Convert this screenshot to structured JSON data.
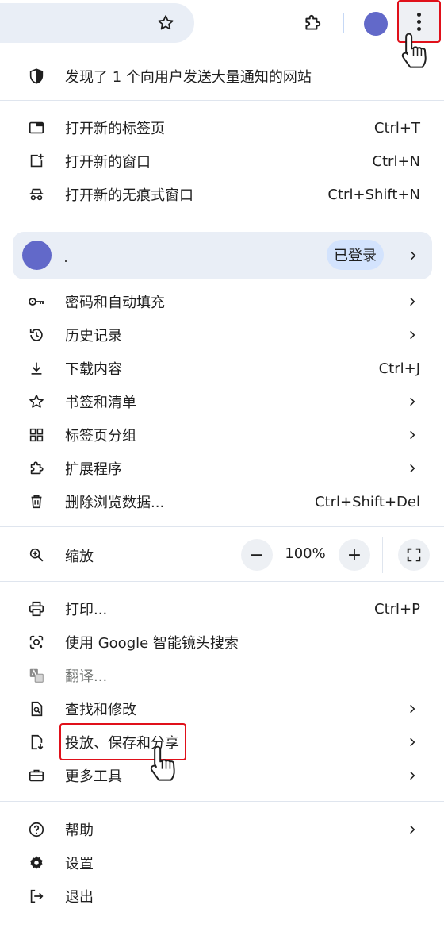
{
  "toolbar": {
    "icons": [
      "star-icon",
      "extension-puzzle-icon",
      "avatar",
      "more-vert-icon"
    ],
    "avatar_color": "#6269c9",
    "highlight_color": "#e0101a"
  },
  "menu": {
    "notification_notice": "发现了 1 个向用户发送大量通知的网站",
    "new_tab": {
      "label": "打开新的标签页",
      "shortcut": "Ctrl+T"
    },
    "new_window": {
      "label": "打开新的窗口",
      "shortcut": "Ctrl+N"
    },
    "new_incognito": {
      "label": "打开新的无痕式窗口",
      "shortcut": "Ctrl+Shift+N"
    },
    "profile": {
      "status": "已登录"
    },
    "passwords": {
      "label": "密码和自动填充"
    },
    "history": {
      "label": "历史记录"
    },
    "downloads": {
      "label": "下载内容",
      "shortcut": "Ctrl+J"
    },
    "bookmarks": {
      "label": "书签和清单"
    },
    "tab_groups": {
      "label": "标签页分组"
    },
    "extensions": {
      "label": "扩展程序"
    },
    "clear_data": {
      "label": "删除浏览数据...",
      "shortcut": "Ctrl+Shift+Del"
    },
    "zoom": {
      "label": "缩放",
      "minus": "−",
      "value": "100%",
      "plus": "+"
    },
    "print": {
      "label": "打印...",
      "shortcut": "Ctrl+P"
    },
    "google_lens": {
      "label": "使用 Google 智能镜头搜索"
    },
    "translate": {
      "label": "翻译..."
    },
    "find_edit": {
      "label": "查找和修改"
    },
    "cast_save_share": {
      "label": "投放、保存和分享"
    },
    "more_tools": {
      "label": "更多工具"
    },
    "help": {
      "label": "帮助"
    },
    "settings": {
      "label": "设置"
    },
    "exit": {
      "label": "退出"
    }
  }
}
